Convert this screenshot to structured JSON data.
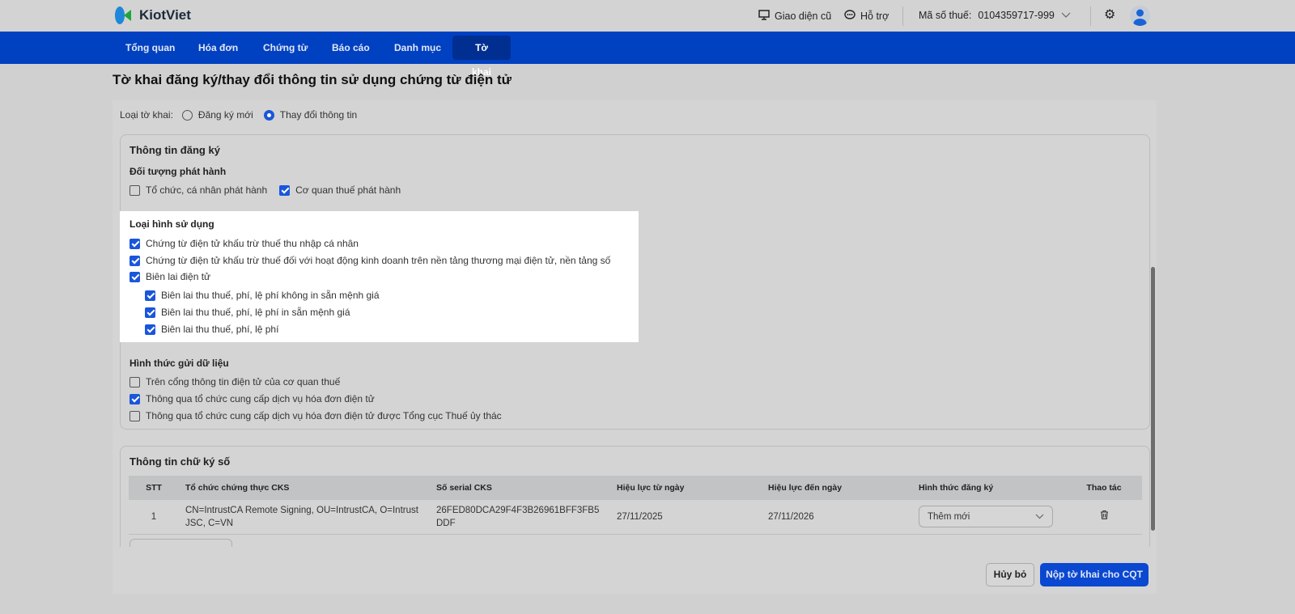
{
  "header": {
    "brand": "KiotViet",
    "old_ui": "Giao diện cũ",
    "support": "Hỗ trợ",
    "tax_label": "Mã số thuế:",
    "tax_value": "0104359717-999"
  },
  "nav": [
    {
      "label": "Tổng quan"
    },
    {
      "label": "Hóa đơn"
    },
    {
      "label": "Chứng từ"
    },
    {
      "label": "Báo cáo"
    },
    {
      "label": "Danh mục"
    },
    {
      "label": "Tờ khai"
    }
  ],
  "page_title": "Tờ khai đăng ký/thay đổi thông tin sử dụng chứng từ điện tử",
  "declaration_type": {
    "label": "Loại tờ khai:",
    "options": [
      {
        "label": "Đăng ký mới",
        "selected": false
      },
      {
        "label": "Thay đổi thông tin",
        "selected": true
      }
    ]
  },
  "registration": {
    "title": "Thông tin đăng ký",
    "issuer": {
      "title": "Đối tượng phát hành",
      "options": [
        {
          "label": "Tổ chức, cá nhân phát hành",
          "checked": false
        },
        {
          "label": "Cơ quan thuế phát hành",
          "checked": true
        }
      ]
    },
    "usage": {
      "title": "Loại hình sử dụng",
      "options": [
        {
          "label": "Chứng từ điện tử khấu trừ thuế thu nhập cá nhân",
          "checked": true
        },
        {
          "label": "Chứng từ điện tử khấu trừ thuế đối với hoạt động kinh doanh trên nền tảng thương mại điện tử, nền tảng số",
          "checked": true
        },
        {
          "label": "Biên lai điện tử",
          "checked": true
        },
        {
          "label": "Biên lai thu thuế, phí, lệ phí không in sẵn mệnh giá",
          "checked": true
        },
        {
          "label": "Biên lai thu thuế, phí, lệ phí in sẵn mệnh giá",
          "checked": true
        },
        {
          "label": "Biên lai thu thuế, phí, lệ phí",
          "checked": true
        }
      ]
    },
    "send": {
      "title": "Hình thức gửi dữ liệu",
      "options": [
        {
          "label": "Trên cổng thông tin điện tử của cơ quan thuế",
          "checked": false
        },
        {
          "label": "Thông qua tổ chức cung cấp dịch vụ hóa đơn điện tử",
          "checked": true
        },
        {
          "label": "Thông qua tổ chức cung cấp dịch vụ hóa đơn điện tử được Tổng cục Thuế ủy thác",
          "checked": false
        }
      ]
    }
  },
  "signature": {
    "title": "Thông tin chữ ký số",
    "columns": [
      "STT",
      "Tổ chức chứng thực CKS",
      "Số serial CKS",
      "Hiệu lực từ ngày",
      "Hiệu lực đến ngày",
      "Hình thức đăng ký",
      "Thao tác"
    ],
    "rows": [
      {
        "stt": "1",
        "org": "CN=IntrustCA Remote Signing, OU=IntrustCA, O=Intrust JSC, C=VN",
        "serial": "26FED80DCA29F4F3B26961BFF3FB5DDF",
        "from": "27/11/2025",
        "to": "27/11/2026",
        "type": "Thêm mới"
      }
    ]
  },
  "actions": {
    "cancel": "Hủy bỏ",
    "submit": "Nộp tờ khai cho CQT"
  },
  "colors": {
    "primary": "#0041c2",
    "checkbox": "#1a56db"
  }
}
